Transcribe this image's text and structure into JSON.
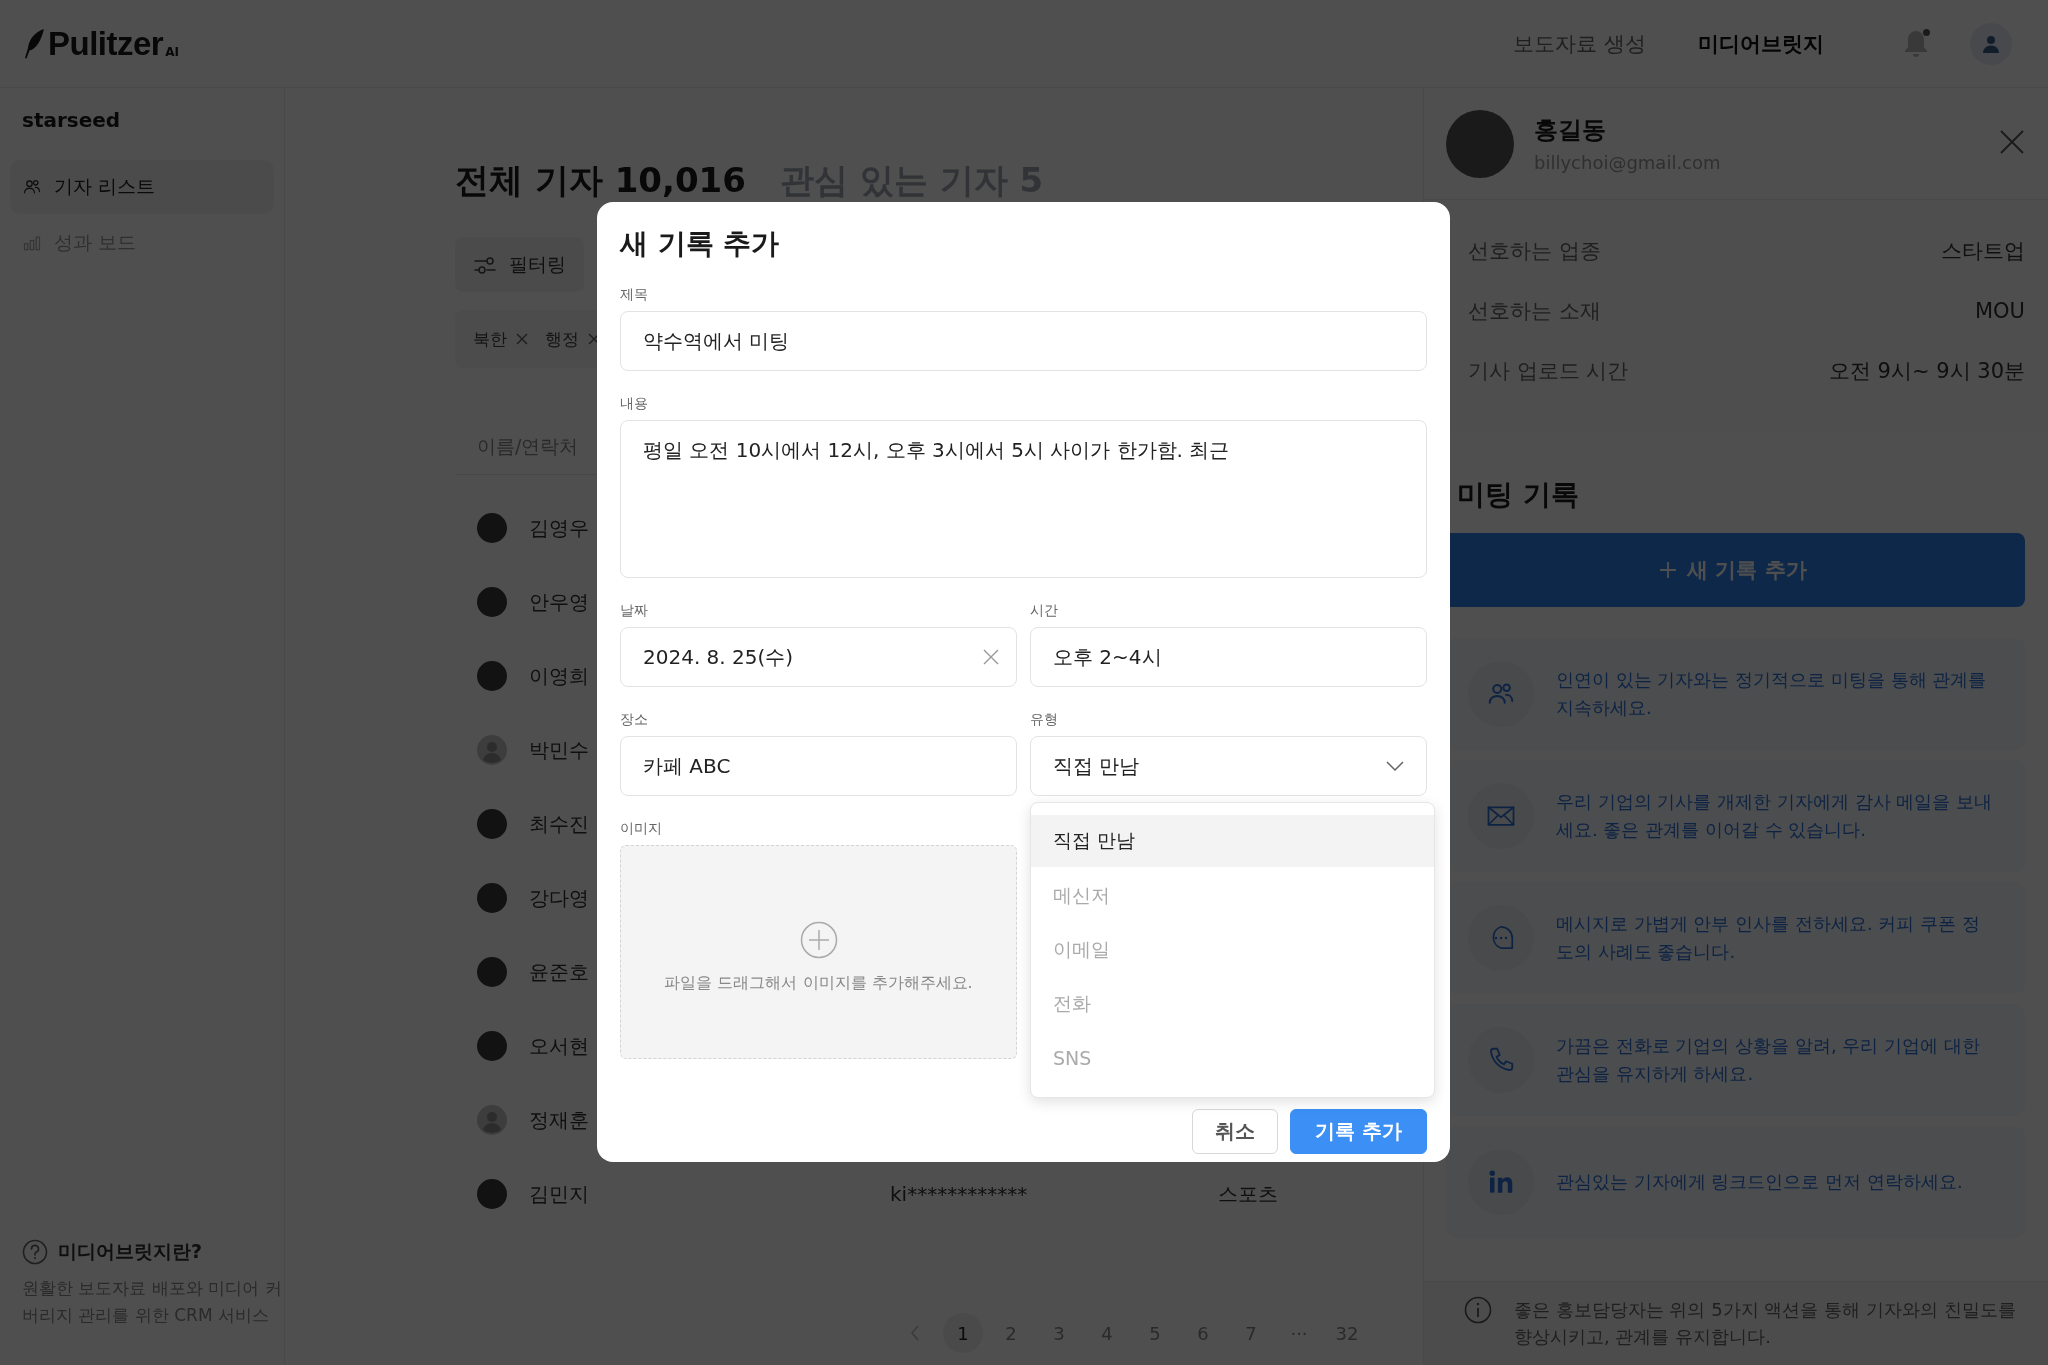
{
  "header": {
    "logo": {
      "name": "Pulitzer",
      "suffix": "AI"
    },
    "nav": [
      {
        "label": "보도자료 생성",
        "selected": false
      },
      {
        "label": "미디어브릿지",
        "selected": true
      }
    ],
    "notifications": {
      "unread": true
    }
  },
  "sidebar": {
    "workspace": "starseed",
    "items": [
      {
        "label": "기자 리스트",
        "selected": true
      },
      {
        "label": "성과 보드",
        "selected": false
      }
    ],
    "help": {
      "title": "미디어브릿지란?",
      "text": "원활한 보도자료 배포와 미디어 커버리지 관리를 위한 CRM 서비스"
    }
  },
  "main": {
    "tabs": [
      {
        "label": "전체 기자 10,016",
        "selected": true
      },
      {
        "label": "관심 있는 기자 5",
        "selected": false
      }
    ],
    "filter_button": "필터링",
    "chips": [
      {
        "label": "북한"
      },
      {
        "label": "행정"
      }
    ],
    "table": {
      "columns": [
        "이름/연락처"
      ],
      "rows": [
        {
          "name": "김영우",
          "kind": "photo"
        },
        {
          "name": "안우영",
          "kind": "photo"
        },
        {
          "name": "이영희",
          "kind": "photo"
        },
        {
          "name": "박민수",
          "kind": "default"
        },
        {
          "name": "최수진",
          "kind": "photo"
        },
        {
          "name": "강다영",
          "kind": "photo"
        },
        {
          "name": "윤준호",
          "kind": "photo"
        },
        {
          "name": "오서현",
          "kind": "photo"
        },
        {
          "name": "정재훈",
          "kind": "default"
        },
        {
          "name": "김민지",
          "kind": "photo",
          "column_2": "ki************",
          "column_3": "스포츠"
        }
      ]
    },
    "pagination": [
      {
        "label": "1",
        "selected": true
      },
      {
        "label": "2",
        "selected": false
      },
      {
        "label": "3",
        "selected": false
      },
      {
        "label": "4",
        "selected": false
      },
      {
        "label": "5",
        "selected": false
      },
      {
        "label": "6",
        "selected": false
      },
      {
        "label": "7",
        "selected": false
      },
      {
        "label": "···",
        "selected": false
      },
      {
        "label": "32",
        "selected": false
      }
    ]
  },
  "detail_panel": {
    "name": "홍길동",
    "email": "billychoi@gmail.com",
    "info": [
      {
        "label": "선호하는 업종",
        "value": "스타트업"
      },
      {
        "label": "선호하는 소재",
        "value": "MOU"
      },
      {
        "label": "기사 업로드 시간",
        "value": "오전 9시~ 9시 30분"
      }
    ],
    "meetings_title": "미팅 기록",
    "add_button": "새 기록 추가",
    "tips": [
      "인연이 있는 기자와는 정기적으로 미팅을 통해 관계를 지속하세요.",
      "우리 기업의 기사를 개제한 기자에게 감사 메일을 보내세요. 좋은 관계를 이어갈 수 있습니다.",
      "메시지로 가볍게 안부 인사를 전하세요. 커피 쿠폰 정도의 사례도 좋습니다.",
      "가끔은 전화로 기업의 상황을 알려, 우리 기업에 대한 관심을 유지하게 하세요.",
      "관심있는 기자에게 링크드인으로 먼저 연락하세요."
    ],
    "footer_note": "좋은 홍보담당자는 위의 5가지 액션을 통해 기자와의 친밀도를 향상시키고, 관계를 유지합니다."
  },
  "modal": {
    "title": "새 기록 추가",
    "rows": [
      [
        {
          "kind": "text",
          "label": "제목",
          "value": "약수역에서 미팅"
        }
      ],
      [
        {
          "kind": "textarea",
          "label": "내용",
          "value": "평일 오전 10시에서 12시, 오후 3시에서 5시 사이가 한가함. 최근"
        }
      ],
      [
        {
          "kind": "date",
          "label": "날짜",
          "value": "2024. 8. 25(수)"
        },
        {
          "kind": "text",
          "label": "시간",
          "value": "오후 2~4시"
        }
      ],
      [
        {
          "kind": "text",
          "label": "장소",
          "value": "카페 ABC"
        },
        {
          "kind": "select",
          "label": "유형",
          "value": "직접 만남",
          "expanded": true,
          "options": [
            {
              "label": "직접 만남",
              "selected": true
            },
            {
              "label": "메신저",
              "selected": false
            },
            {
              "label": "이메일",
              "selected": false
            },
            {
              "label": "전화",
              "selected": false
            },
            {
              "label": "SNS",
              "selected": false
            }
          ]
        }
      ],
      [
        {
          "kind": "upload",
          "label": "이미지",
          "placeholder": "파일을 드래그해서 이미지를 추가해주세요."
        }
      ]
    ],
    "buttons": [
      {
        "label": "취소",
        "kind": "secondary"
      },
      {
        "label": "기록 추가",
        "kind": "primary"
      }
    ]
  }
}
